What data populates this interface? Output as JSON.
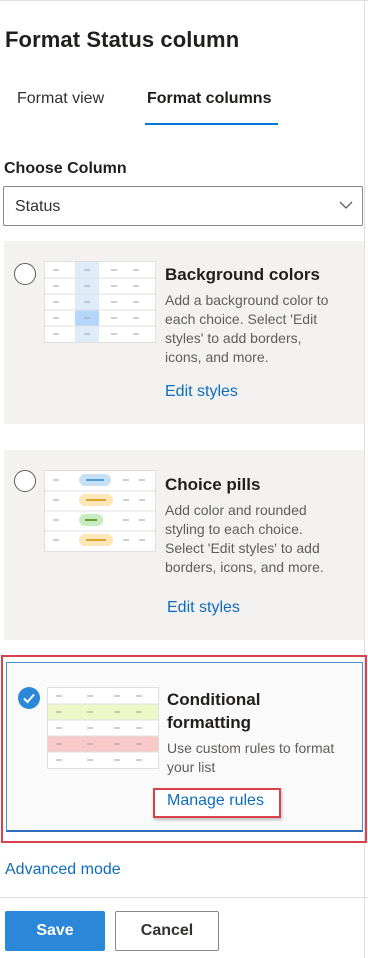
{
  "panel": {
    "title": "Format Status column",
    "tabs": [
      {
        "label": "Format view",
        "active": false
      },
      {
        "label": "Format columns",
        "active": true
      }
    ]
  },
  "choose_column": {
    "label": "Choose Column",
    "selected": "Status"
  },
  "options": [
    {
      "title": "Background colors",
      "description": [
        "Add a background color to",
        "each choice. Select 'Edit",
        "styles' to add borders,",
        "icons, and more."
      ],
      "link": "Edit styles",
      "selected": false
    },
    {
      "title": "Choice pills",
      "description": [
        "Add color and rounded",
        "styling to each choice.",
        "Select 'Edit styles' to add",
        "borders, icons, and more."
      ],
      "link": "Edit styles",
      "selected": false
    },
    {
      "title_lines": [
        "Conditional",
        "formatting"
      ],
      "description": [
        "Use custom rules to format",
        "your list"
      ],
      "link": "Manage rules",
      "selected": true
    }
  ],
  "advanced_link": "Advanced mode",
  "footer": {
    "save": "Save",
    "cancel": "Cancel"
  },
  "colors": {
    "accent": "#0078d4",
    "link": "#0f6cbd",
    "highlight": "#d9414b",
    "card_bg": "#f3f2f1",
    "pill_blue": "#c7e0f4",
    "pill_orange": "#fde7b6",
    "pill_green": "#c8ecc2",
    "row_yellow": "#eef7c8",
    "row_red": "#f7c9c9"
  },
  "icons": {
    "dropdown": "chevron-down-icon",
    "selected_radio": "checkmark-circle-icon"
  }
}
